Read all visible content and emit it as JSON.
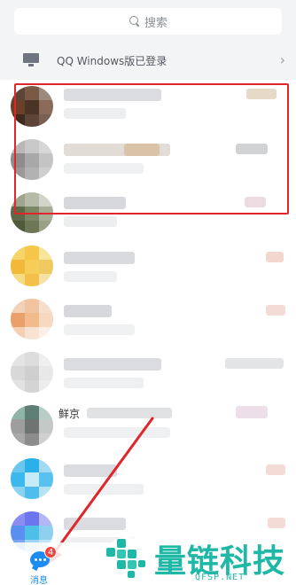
{
  "search": {
    "placeholder": "搜索"
  },
  "device_banner": {
    "label": "QQ Windows版已登录"
  },
  "conversations": [
    {
      "name_visible": ""
    },
    {
      "name_visible": ""
    },
    {
      "name_visible": ""
    },
    {
      "name_visible": ""
    },
    {
      "name_visible": ""
    },
    {
      "name_visible": ""
    },
    {
      "name_visible": "鲜京"
    },
    {
      "name_visible": ""
    },
    {
      "name_visible": ""
    }
  ],
  "tabbar": {
    "messages_label": "消息",
    "messages_badge": "4"
  },
  "watermark": {
    "brand": "量链科技",
    "domain": "QFSP.NET"
  },
  "colors": {
    "accent": "#1d8cf0",
    "highlight": "#e0262b",
    "badge": "#f2453d",
    "watermark": "#1fb8a6"
  }
}
